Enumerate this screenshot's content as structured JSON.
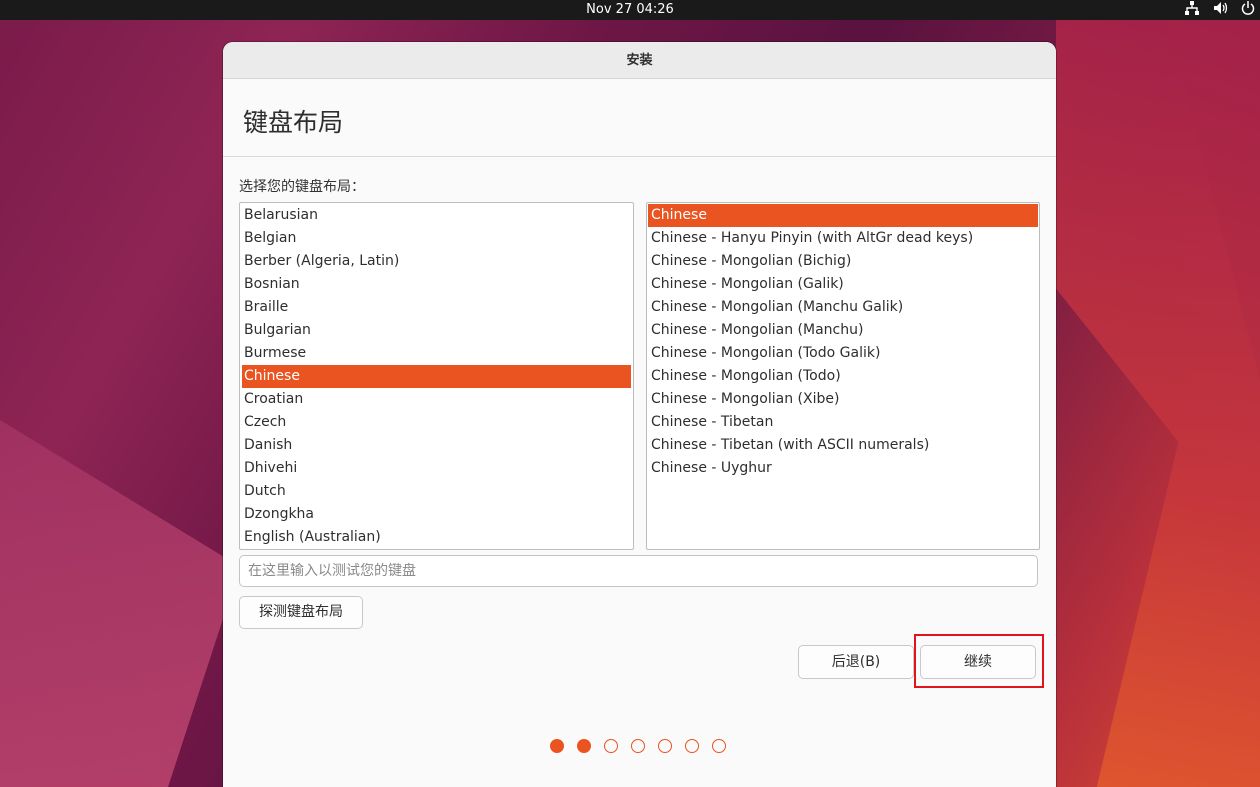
{
  "topbar": {
    "clock": "Nov 27  04:26",
    "icons": [
      "network-icon",
      "volume-icon",
      "power-icon"
    ]
  },
  "window": {
    "title": "安装"
  },
  "page": {
    "heading": "键盘布局",
    "prompt": "选择您的键盘布局："
  },
  "layouts": {
    "items": [
      "Belarusian",
      "Belgian",
      "Berber (Algeria, Latin)",
      "Bosnian",
      "Braille",
      "Bulgarian",
      "Burmese",
      "Chinese",
      "Croatian",
      "Czech",
      "Danish",
      "Dhivehi",
      "Dutch",
      "Dzongkha",
      "English (Australian)"
    ],
    "selected": "Chinese"
  },
  "variants": {
    "items": [
      "Chinese",
      "Chinese - Hanyu Pinyin (with AltGr dead keys)",
      "Chinese - Mongolian (Bichig)",
      "Chinese - Mongolian (Galik)",
      "Chinese - Mongolian (Manchu Galik)",
      "Chinese - Mongolian (Manchu)",
      "Chinese - Mongolian (Todo Galik)",
      "Chinese - Mongolian (Todo)",
      "Chinese - Mongolian (Xibe)",
      "Chinese - Tibetan",
      "Chinese - Tibetan (with ASCII numerals)",
      "Chinese - Uyghur"
    ],
    "selected": "Chinese"
  },
  "test_field": {
    "placeholder": "在这里输入以测试您的键盘",
    "value": ""
  },
  "buttons": {
    "detect": "探测键盘布局",
    "back": "后退(B)",
    "continue": "继续"
  },
  "progress": {
    "total": 7,
    "completed": 2
  },
  "colors": {
    "accent": "#e95420",
    "highlight_box": "#e1141c"
  }
}
